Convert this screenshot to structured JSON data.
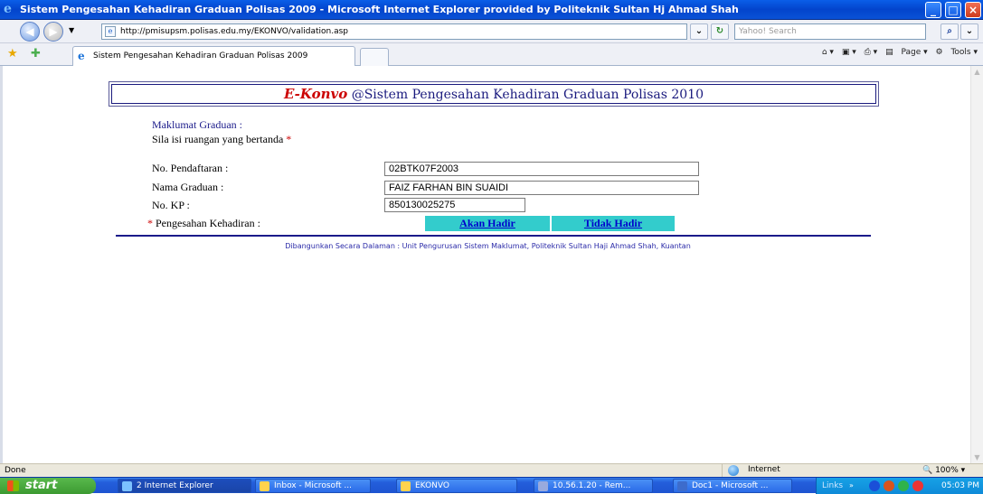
{
  "window": {
    "title": "Sistem Pengesahan Kehadiran Graduan Polisas 2009 - Microsoft Internet Explorer provided by Politeknik Sultan Hj Ahmad Shah"
  },
  "browser": {
    "url": "http://pmisupsm.polisas.edu.my/EKONVO/validation.asp",
    "search_placeholder": "Yahoo! Search",
    "tab_title": "Sistem Pengesahan Kehadiran Graduan Polisas 2009",
    "cmd_page": "Page",
    "cmd_tools": "Tools"
  },
  "page": {
    "brand": "E-Konvo",
    "header": "@Sistem Pengesahan Kehadiran Graduan Polisas 2010",
    "section_title": "Maklumat Graduan :",
    "instruction": "Sila isi ruangan yang bertanda",
    "required_mark": "*",
    "fields": {
      "no_pendaftaran_label": "No. Pendaftaran :",
      "no_pendaftaran_value": "02BTK07F2003",
      "nama_label": "Nama Graduan :",
      "nama_value": "FAIZ FARHAN BIN SUAIDI",
      "kp_label": "No. KP :",
      "kp_value": "850130025275",
      "pengesahan_label": "Pengesahan Kehadiran :"
    },
    "buttons": {
      "akan_hadir": "Akan Hadir",
      "tidak_hadir": "Tidak Hadir"
    },
    "footer": "Dibangunkan Secara Dalaman : Unit Pengurusan Sistem Maklumat, Politeknik Sultan Haji Ahmad Shah, Kuantan"
  },
  "status": {
    "text": "Done",
    "zone": "Internet",
    "zoom": "100%"
  },
  "taskbar": {
    "start": "start",
    "items": [
      "2 Internet Explorer",
      "Inbox - Microsoft ...",
      "EKONVO",
      "10.56.1.20 - Rem...",
      "Doc1 - Microsoft ..."
    ],
    "links": "Links",
    "clock": "05:03 PM"
  }
}
